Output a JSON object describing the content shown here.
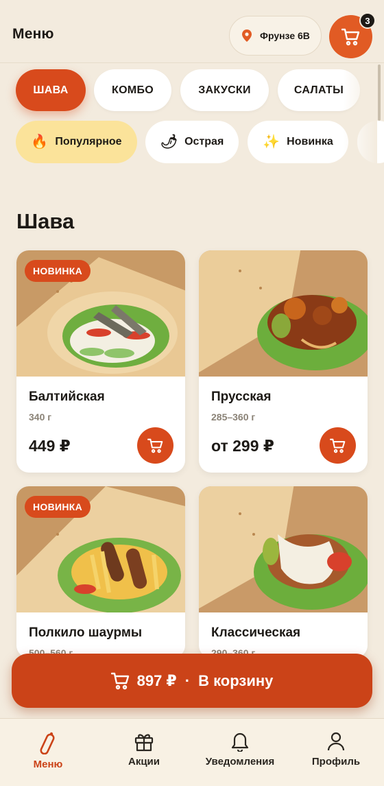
{
  "header": {
    "title": "Меню",
    "location": "Фрунзе 6В",
    "cart_count": "3"
  },
  "categories": [
    {
      "label": "ШАВА",
      "active": true
    },
    {
      "label": "КОМБО",
      "active": false
    },
    {
      "label": "ЗАКУСКИ",
      "active": false
    },
    {
      "label": "САЛАТЫ",
      "active": false
    }
  ],
  "filters": [
    {
      "label": "Популярное",
      "emoji": "🔥",
      "active": true
    },
    {
      "label": "Острая",
      "emoji": "🌶",
      "active": false
    },
    {
      "label": "Новинка",
      "emoji": "✨",
      "active": false
    }
  ],
  "section_title": "Шава",
  "products": [
    {
      "name": "Балтийская",
      "weight": "340 г",
      "price": "449 ₽",
      "badge": "НОВИНКА"
    },
    {
      "name": "Прусская",
      "weight": "285–360 г",
      "price": "от 299 ₽",
      "badge": ""
    },
    {
      "name": "Полкило шаурмы",
      "weight": "500–560 г",
      "price": "",
      "badge": "НОВИНКА"
    },
    {
      "name": "Классическая",
      "weight": "290–360 г",
      "price": "",
      "badge": ""
    }
  ],
  "cart_bar": {
    "total": "897 ₽",
    "separator": "·",
    "label": "В корзину"
  },
  "nav": [
    {
      "label": "Меню",
      "icon": "shawarma-icon",
      "active": true
    },
    {
      "label": "Акции",
      "icon": "gift-icon",
      "active": false
    },
    {
      "label": "Уведомления",
      "icon": "bell-icon",
      "active": false
    },
    {
      "label": "Профиль",
      "icon": "user-icon",
      "active": false
    }
  ],
  "colors": {
    "accent": "#d84a1c",
    "background": "#f3ebde",
    "filter_active": "#fbe39a"
  }
}
